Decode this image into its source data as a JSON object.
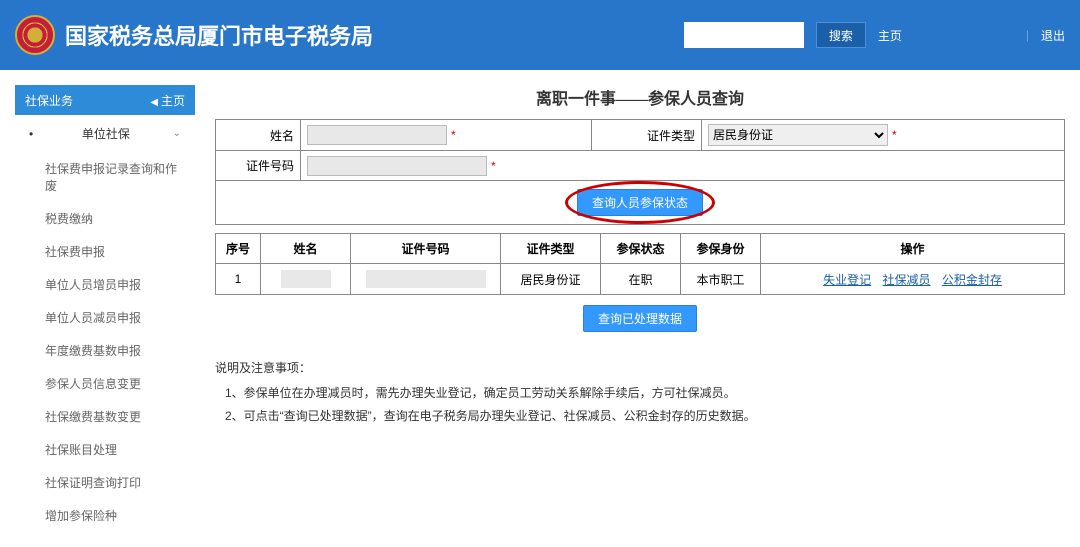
{
  "header": {
    "site_title": "国家税务总局厦门市电子税务局",
    "search_placeholder": "",
    "search_btn": "搜索",
    "home": "主页",
    "logout": "退出"
  },
  "sidebar": {
    "header": "社保业务",
    "home_link": "主页",
    "parent": "单位社保",
    "items": [
      "社保费申报记录查询和作废",
      "税费缴纳",
      "社保费申报",
      "单位人员增员申报",
      "单位人员减员申报",
      "年度缴费基数申报",
      "参保人员信息变更",
      "社保缴费基数变更",
      "社保账目处理",
      "社保证明查询打印",
      "增加参保险种"
    ]
  },
  "page": {
    "title": "离职一件事——参保人员查询",
    "form": {
      "name_label": "姓名",
      "name_value": "",
      "id_type_label": "证件类型",
      "id_type_value": "居民身份证",
      "id_no_label": "证件号码",
      "id_no_value": ""
    },
    "query_btn": "查询人员参保状态",
    "grid": {
      "headers": [
        "序号",
        "姓名",
        "证件号码",
        "证件类型",
        "参保状态",
        "参保身份",
        "操作"
      ],
      "rows": [
        {
          "seq": "1",
          "name": "",
          "id_no": "",
          "id_type": "居民身份证",
          "status": "在职",
          "identity": "本市职工",
          "actions": [
            "失业登记",
            "社保减员",
            "公积金封存"
          ]
        }
      ]
    },
    "processed_btn": "查询已处理数据",
    "notes": {
      "title": "说明及注意事项：",
      "lines": [
        "1、参保单位在办理减员时，需先办理失业登记，确定员工劳动关系解除手续后，方可社保减员。",
        "2、可点击“查询已处理数据”，查询在电子税务局办理失业登记、社保减员、公积金封存的历史数据。"
      ]
    }
  }
}
